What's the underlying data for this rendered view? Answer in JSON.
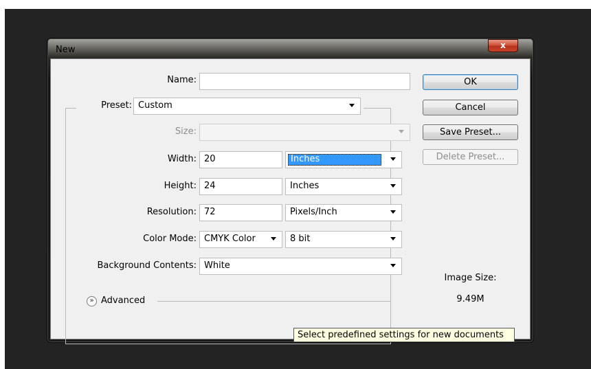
{
  "window": {
    "title": "New",
    "close_label": "x"
  },
  "form": {
    "name": {
      "label": "Name:",
      "value": ""
    },
    "preset": {
      "label": "Preset:",
      "value": "Custom"
    },
    "size": {
      "label": "Size:",
      "value": ""
    },
    "width": {
      "label": "Width:",
      "value": "20",
      "unit": "Inches"
    },
    "height": {
      "label": "Height:",
      "value": "24",
      "unit": "Inches"
    },
    "resolution": {
      "label": "Resolution:",
      "value": "72",
      "unit": "Pixels/Inch"
    },
    "color_mode": {
      "label": "Color Mode:",
      "value": "CMYK Color",
      "depth": "8 bit"
    },
    "background": {
      "label": "Background Contents:",
      "value": "White"
    },
    "advanced": {
      "icon": "»",
      "label": "Advanced"
    }
  },
  "buttons": {
    "ok": "OK",
    "cancel": "Cancel",
    "save_preset": "Save Preset...",
    "delete_preset": "Delete Preset..."
  },
  "image_size": {
    "label": "Image Size:",
    "value": "9.49M"
  },
  "tooltip": "Select predefined settings for new documents",
  "colors": {
    "selection": "#3399ff",
    "tooltip_bg": "#ffffe1",
    "app_bg": "#232323"
  }
}
